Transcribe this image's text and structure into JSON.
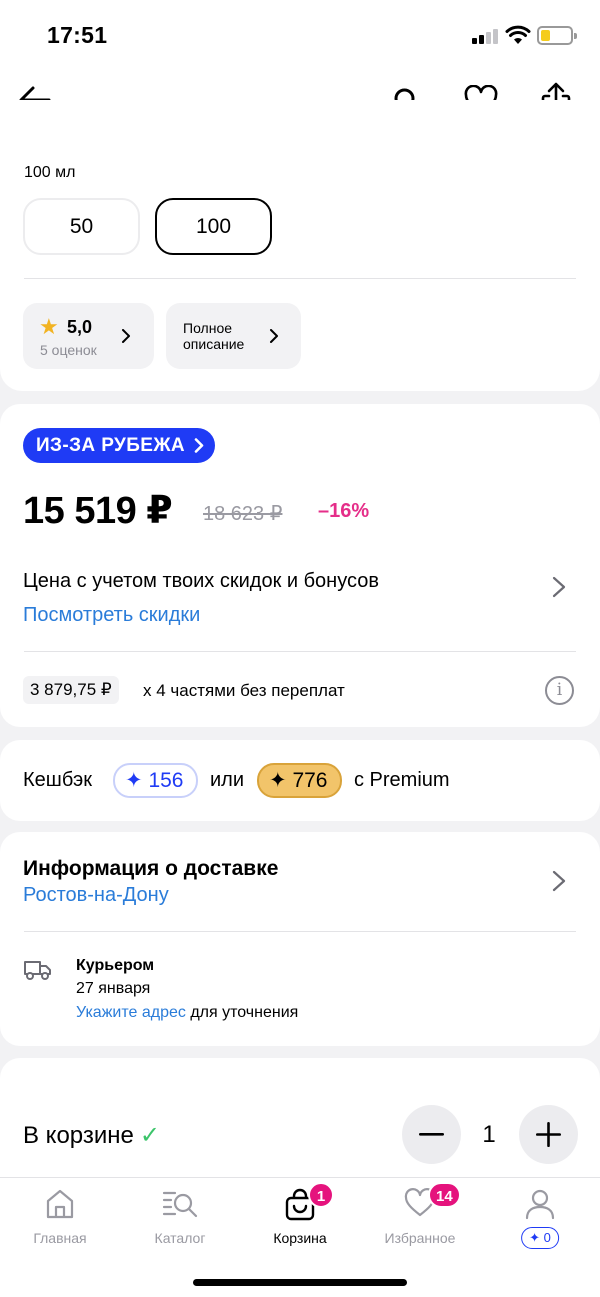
{
  "status_bar": {
    "time": "17:51"
  },
  "product": {
    "volume_label": "100 мл",
    "volumes": [
      {
        "label": "50",
        "selected": false
      },
      {
        "label": "100",
        "selected": true
      }
    ],
    "rating": {
      "value": "5,0",
      "count": "5 оценок"
    },
    "full_description_label": "Полное описание"
  },
  "price_block": {
    "abroad_badge": "ИЗ-ЗА РУБЕЖА",
    "price": "15 519 ₽",
    "old_price": "18 623 ₽",
    "discount": "–16%",
    "note": "Цена с учетом твоих скидок и бонусов",
    "see_discounts": "Посмотреть скидки",
    "installment_amount": "3 879,75 ₽",
    "installment_text": "х 4 частями без переплат"
  },
  "cashback": {
    "label": "Кешбэк",
    "value": "156",
    "or": "или",
    "premium_value": "776",
    "premium_label": "с Premium"
  },
  "delivery": {
    "title": "Информация о доставке",
    "city": "Ростов-на-Дону",
    "courier_title": "Курьером",
    "courier_date": "27 января",
    "address_link": "Укажите адрес",
    "address_suffix": "для уточнения"
  },
  "cart_bar": {
    "in_cart": "В корзине",
    "quantity": "1"
  },
  "tabs": [
    {
      "label": "Главная",
      "icon": "home-icon"
    },
    {
      "label": "Каталог",
      "icon": "catalog-search-icon"
    },
    {
      "label": "Корзина",
      "icon": "cart-icon",
      "badge": "1",
      "active": true
    },
    {
      "label": "Избранное",
      "icon": "heart-icon",
      "badge": "14"
    },
    {
      "label": "",
      "icon": "profile-icon",
      "bonus": "0"
    }
  ],
  "colors": {
    "accent_blue": "#1f3bf5",
    "link_blue": "#2a7cd9",
    "discount_pink": "#e52e89",
    "badge_pink": "#e5137d",
    "premium_gold": "#f2c46a"
  }
}
